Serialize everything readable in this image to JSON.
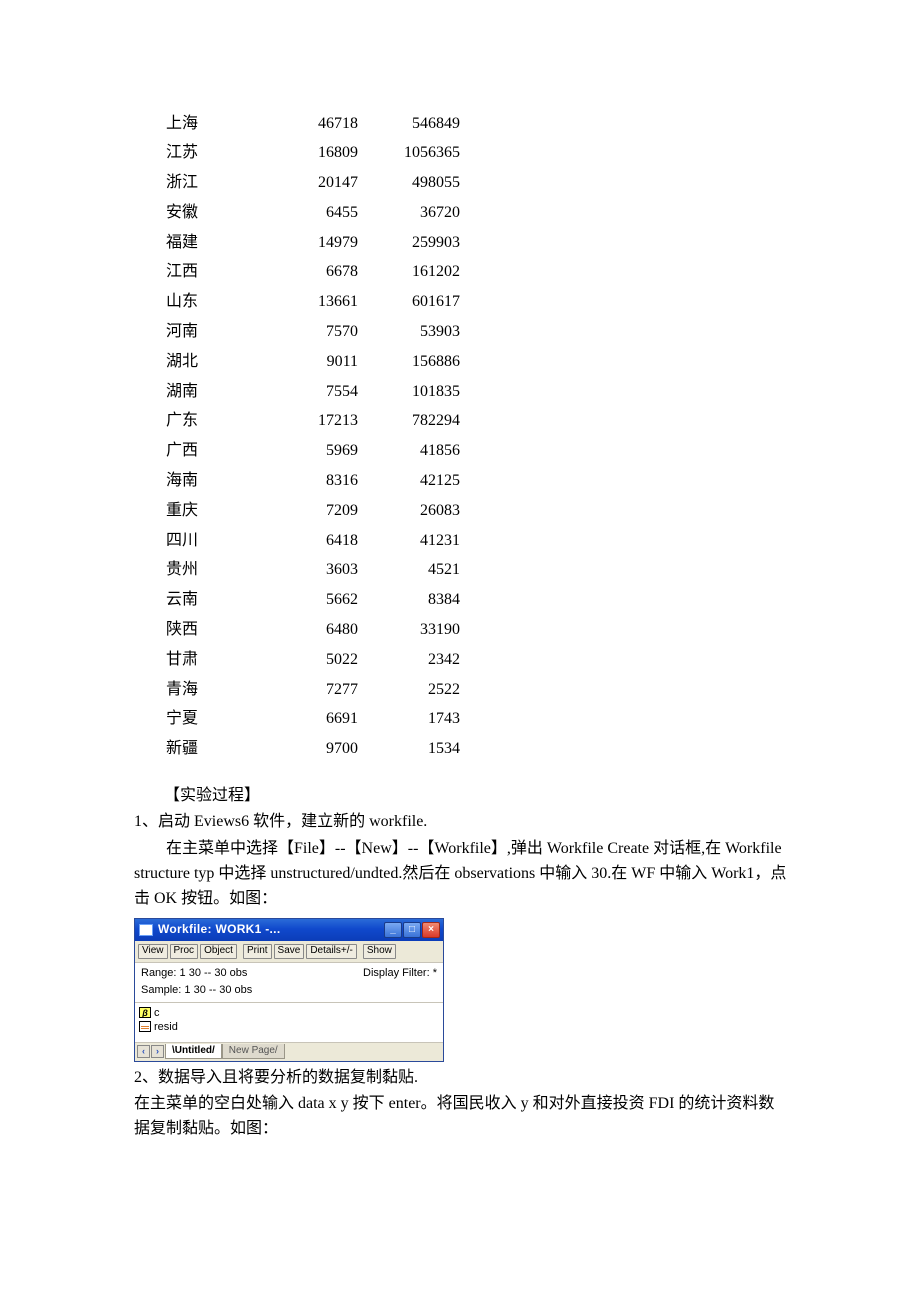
{
  "data_rows": [
    {
      "region": "上海",
      "v1": "46718",
      "v2": "546849"
    },
    {
      "region": "江苏",
      "v1": "16809",
      "v2": "1056365"
    },
    {
      "region": "浙江",
      "v1": "20147",
      "v2": "498055"
    },
    {
      "region": "安徽",
      "v1": "6455",
      "v2": "36720"
    },
    {
      "region": "福建",
      "v1": "14979",
      "v2": "259903"
    },
    {
      "region": "江西",
      "v1": "6678",
      "v2": "161202"
    },
    {
      "region": "山东",
      "v1": "13661",
      "v2": "601617"
    },
    {
      "region": "河南",
      "v1": "7570",
      "v2": "53903"
    },
    {
      "region": "湖北",
      "v1": "9011",
      "v2": "156886"
    },
    {
      "region": "湖南",
      "v1": "7554",
      "v2": "101835"
    },
    {
      "region": "广东",
      "v1": "17213",
      "v2": "782294"
    },
    {
      "region": "广西",
      "v1": "5969",
      "v2": "41856"
    },
    {
      "region": "海南",
      "v1": "8316",
      "v2": "42125"
    },
    {
      "region": "重庆",
      "v1": "7209",
      "v2": "26083"
    },
    {
      "region": "四川",
      "v1": "6418",
      "v2": "41231"
    },
    {
      "region": "贵州",
      "v1": "3603",
      "v2": "4521"
    },
    {
      "region": "云南",
      "v1": "5662",
      "v2": "8384"
    },
    {
      "region": "陕西",
      "v1": "6480",
      "v2": "33190"
    },
    {
      "region": "甘肃",
      "v1": "5022",
      "v2": "2342"
    },
    {
      "region": "青海",
      "v1": "7277",
      "v2": "2522"
    },
    {
      "region": "宁夏",
      "v1": "6691",
      "v2": "1743"
    },
    {
      "region": "新疆",
      "v1": "9700",
      "v2": "1534"
    }
  ],
  "headings": {
    "experiment_process": "【实验过程】"
  },
  "steps": {
    "s1_line1": "1、启动 Eviews6 软件，建立新的 workfile.",
    "s1_line2": "在主菜单中选择【File】--【New】--【Workfile】,弹出 Workfile Create 对话框,在 Workfile structure typ 中选择 unstructured/undted.然后在 observations 中输入 30.在 WF 中输入 Work1，点击 OK 按钮。如图：",
    "s2_line1": "2、数据导入且将要分析的数据复制黏贴.",
    "s2_line2": "在主菜单的空白处输入 data x y 按下 enter。将国民收入 y 和对外直接投资 FDI 的统计资料数据复制黏贴。如图："
  },
  "workfile": {
    "title": "Workfile: WORK1 -...",
    "toolbar": [
      "View",
      "Proc",
      "Object",
      "Print",
      "Save",
      "Details+/-",
      "Show"
    ],
    "range_label": "Range: 1 30  --  30 obs",
    "sample_label": "Sample: 1 30  --  30 obs",
    "filter_label": "Display Filter: *",
    "obj_c": "c",
    "obj_resid": "resid",
    "tab_active": "Untitled",
    "tab_inactive": "New Page"
  }
}
